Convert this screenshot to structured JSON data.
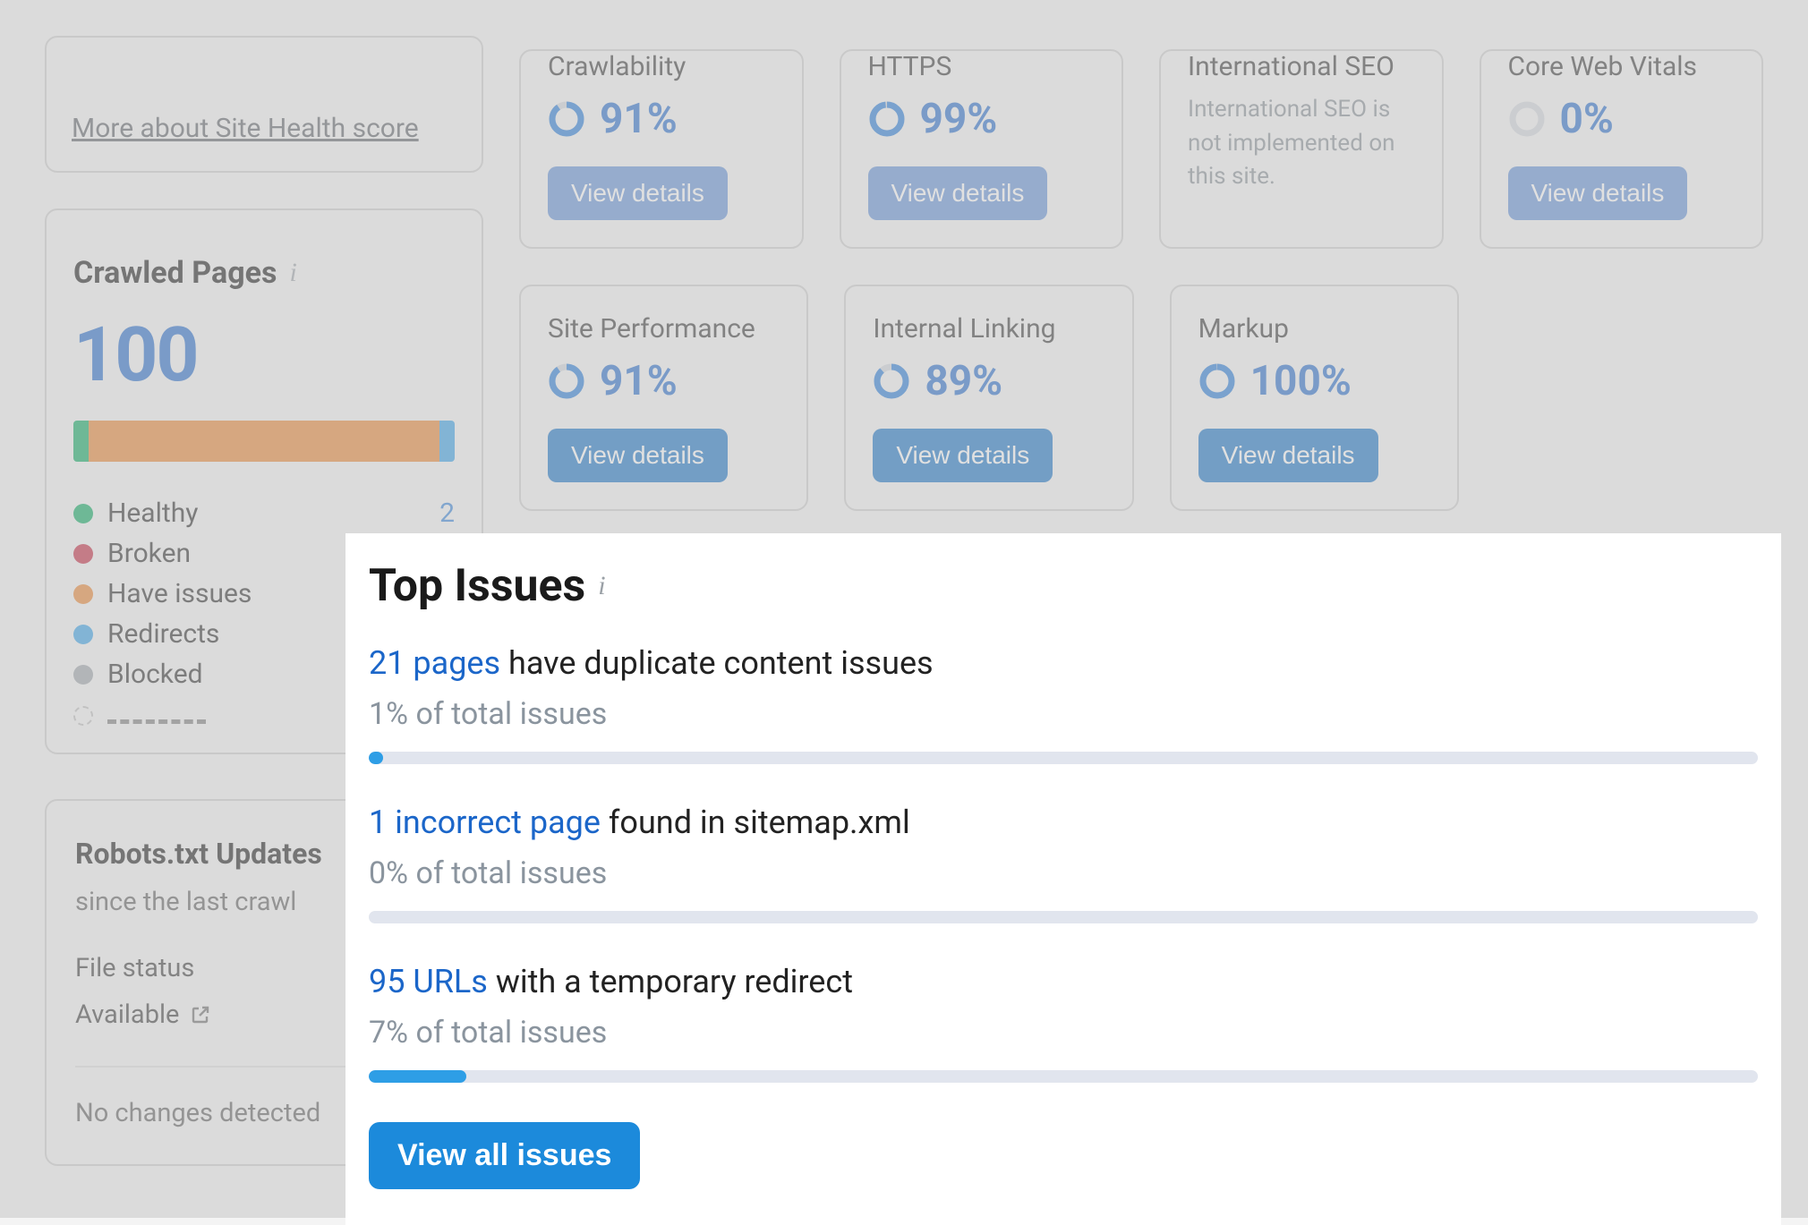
{
  "colors": {
    "accent": "#1b66c9",
    "healthy": "#00a65a",
    "broken": "#c01f3a",
    "issues": "#e97f28",
    "redirects": "#2e9ee6",
    "blocked": "#9aa0a6"
  },
  "top_left": {
    "more_link": "More about Site Health score"
  },
  "crawled": {
    "title": "Crawled Pages",
    "value": "100",
    "legend": {
      "healthy": {
        "label": "Healthy",
        "count": "2"
      },
      "broken": {
        "label": "Broken"
      },
      "have_issues": {
        "label": "Have issues"
      },
      "redirects": {
        "label": "Redirects"
      },
      "blocked": {
        "label": "Blocked"
      }
    }
  },
  "metrics_row1": {
    "crawlability": {
      "title": "Crawlability",
      "pct": "91%",
      "pct_num": 91
    },
    "https": {
      "title": "HTTPS",
      "pct": "99%",
      "pct_num": 99
    },
    "intl": {
      "title": "International SEO",
      "note": "International SEO is not implemented on this site."
    },
    "cwv": {
      "title": "Core Web Vitals",
      "pct": "0%",
      "pct_num": 0
    }
  },
  "metrics_row2": {
    "perf": {
      "title": "Site Performance",
      "pct": "91%",
      "pct_num": 91
    },
    "ilink": {
      "title": "Internal Linking",
      "pct": "89%",
      "pct_num": 89
    },
    "markup": {
      "title": "Markup",
      "pct": "100%",
      "pct_num": 100
    }
  },
  "buttons": {
    "view_details": "View details",
    "view_all_issues": "View all issues"
  },
  "robots": {
    "title": "Robots.txt Updates",
    "subtitle": "since the last crawl",
    "status_label": "File status",
    "status_value": "Available",
    "changes": "No changes detected"
  },
  "top_issues": {
    "title": "Top Issues",
    "items": [
      {
        "link": "21 pages",
        "text": " have duplicate content issues",
        "sub": "1% of total issues",
        "pct": 1
      },
      {
        "link": "1 incorrect page",
        "text": " found in sitemap.xml",
        "sub": "0% of total issues",
        "pct": 0
      },
      {
        "link": "95 URLs",
        "text": " with a temporary redirect",
        "sub": "7% of total issues",
        "pct": 7
      }
    ]
  }
}
